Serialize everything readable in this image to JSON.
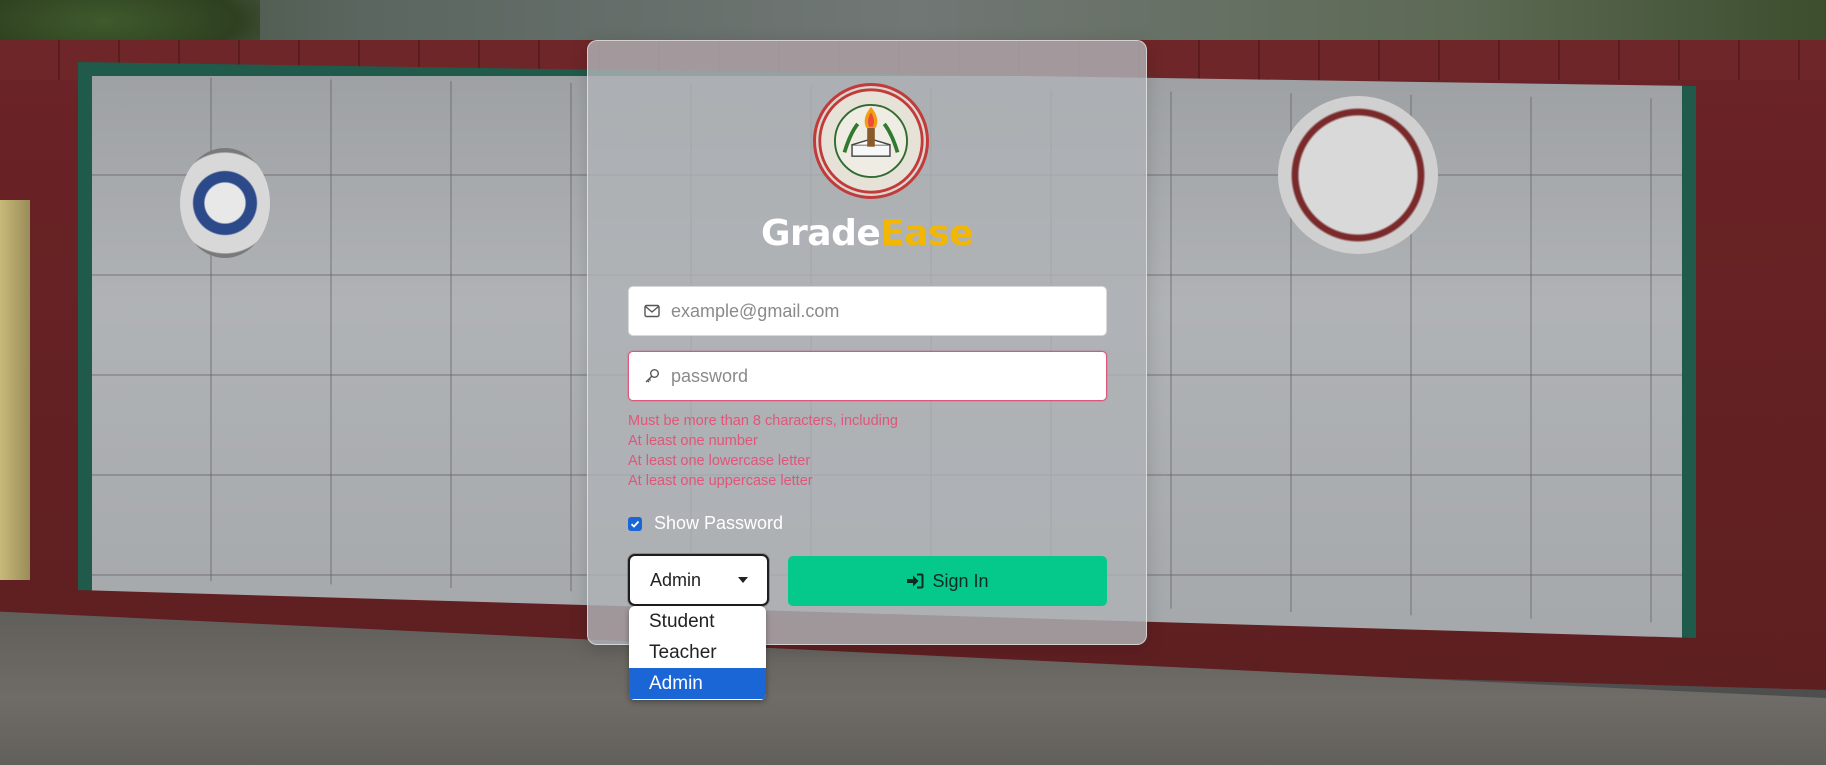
{
  "brand": {
    "part1": "Grade",
    "part2": "Ease"
  },
  "login": {
    "email_placeholder": "example@gmail.com",
    "password_placeholder": "password",
    "errors": [
      "Must be more than 8 characters, including",
      "At least one number",
      "At least one lowercase letter",
      "At least one uppercase letter"
    ],
    "show_password_label": "Show Password",
    "show_password_checked": true,
    "role_selected": "Admin",
    "role_options": [
      "Student",
      "Teacher",
      "Admin"
    ],
    "sign_in_label": "Sign In"
  },
  "colors": {
    "accent_green": "#05c98a",
    "brand_yellow": "#f2b705",
    "error_pink": "#e0567a",
    "selection_blue": "#1a66d6"
  },
  "icons": {
    "email": "envelope-icon",
    "password": "key-icon",
    "dropdown": "caret-down-icon",
    "sign_in": "sign-in-icon"
  }
}
